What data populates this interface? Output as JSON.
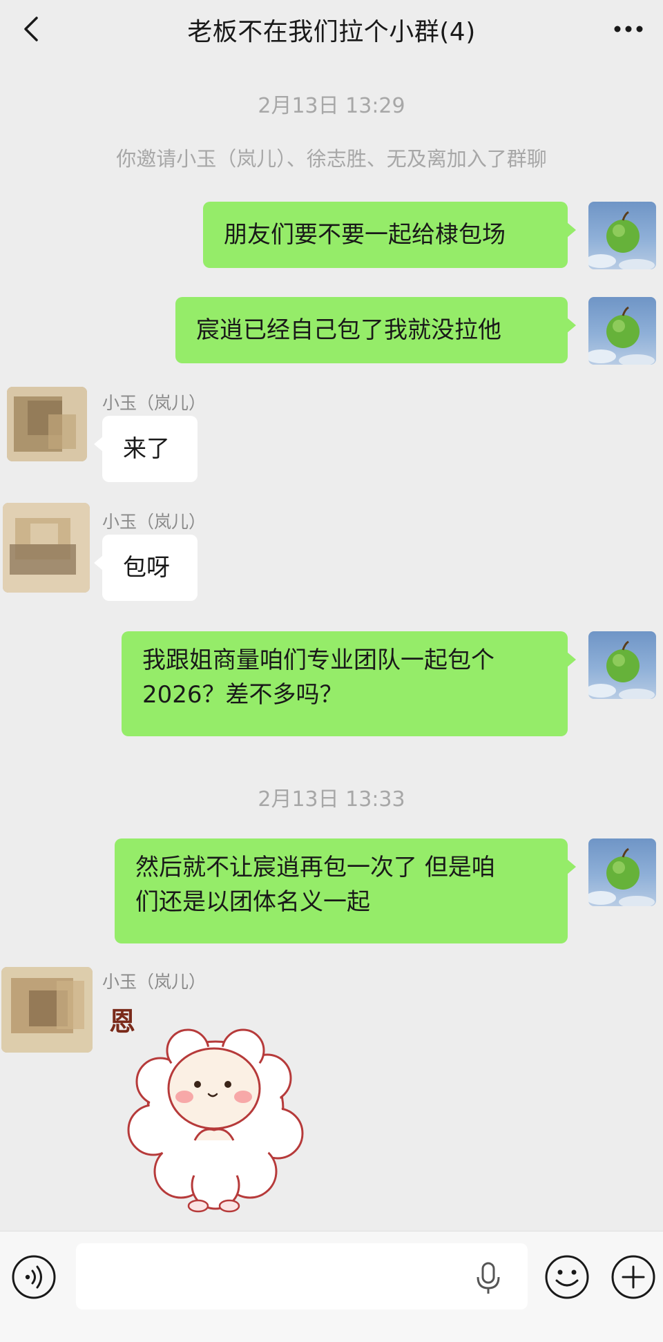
{
  "header": {
    "title": "老板不在我们拉个小群(4)",
    "back_icon": "chevron-left-icon",
    "more_icon": "ellipsis-icon"
  },
  "messages": {
    "ts1": "2月13日 13:29",
    "system1": "你邀请小玉（岚儿）、徐志胜、无及离加入了群聊",
    "m1": "朋友们要不要一起给棣包场",
    "m2": "宸逍已经自己包了我就没拉他",
    "m3_name": "小玉（岚儿）",
    "m3": "来了",
    "m4_name": "小玉（岚儿）",
    "m4": "包呀",
    "m5_line1": "我跟姐商量咱们专业团队一起包个",
    "m5_line2": "2026？差不多吗？",
    "ts2": "2月13日 13:33",
    "m6_line1": "然后就不让宸逍再包一次了 但是咱",
    "m6_line2": "们还是以团体名义一起",
    "m7_name": "小玉（岚儿）"
  },
  "sticker": {
    "glyph": "恩"
  },
  "input_bar": {
    "text_value": "",
    "voice_icon": "voice-wave-icon",
    "mic_icon": "microphone-icon",
    "emoji_icon": "smile-face-icon",
    "plus_icon": "plus-circle-icon"
  },
  "colors": {
    "background": "#ededed",
    "self_bubble": "#95ec69",
    "other_bubble": "#ffffff",
    "meta_text": "#a7a7a7"
  }
}
